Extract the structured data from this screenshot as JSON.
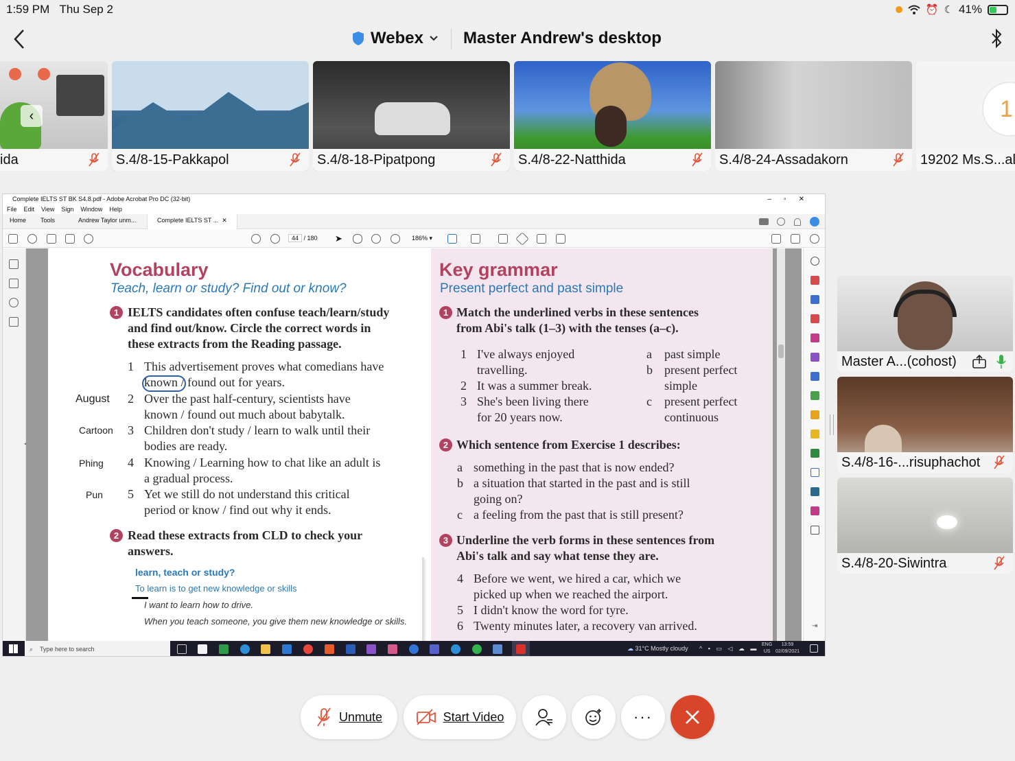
{
  "status_bar": {
    "time": "1:59 PM",
    "date": "Thu Sep 2",
    "battery": "41%",
    "battery_level": 0.41
  },
  "header": {
    "app": "Webex",
    "title": "Master Andrew's desktop"
  },
  "participants": [
    {
      "name": "ida"
    },
    {
      "name": "S.4/8-15-Pakkapol"
    },
    {
      "name": "S.4/8-18-Pipatpong"
    },
    {
      "name": "S.4/8-22-Natthida"
    },
    {
      "name": "S.4/8-24-Assadakorn"
    },
    {
      "name": "19202 Ms.S...al"
    }
  ],
  "video_column": [
    {
      "name": "Master A...(cohost)"
    },
    {
      "name": "S.4/8-16-...risuphachot"
    },
    {
      "name": "S.4/8-20-Siwintra"
    }
  ],
  "acrobat": {
    "title": "Complete IELTS ST BK S4.8.pdf - Adobe Acrobat Pro DC (32-bit)",
    "menu": [
      "File",
      "Edit",
      "View",
      "Sign",
      "Window",
      "Help"
    ],
    "tabs": [
      "Home",
      "Tools",
      "Andrew Taylor unm...",
      "Complete IELTS ST ..."
    ],
    "page_current": "44",
    "page_total": "/ 180",
    "zoom": "186%"
  },
  "vocab": {
    "title": "Vocabulary",
    "subtitle": "Teach, learn or study? Find out or know?",
    "q1": "IELTS candidates often confuse teach/learn/study and find out/know. Circle the correct words in these extracts from the Reading passage.",
    "q1_lines": [
      "IELTS candidates often confuse teach/learn/study",
      "and find out/know. Circle the correct words in",
      "these extracts from the Reading passage."
    ],
    "items": [
      {
        "n": "1",
        "l1": "This advertisement proves what comedians have",
        "l2": "known / found out for years."
      },
      {
        "n": "2",
        "l1": "Over the past half-century, scientists have",
        "l2": "known / found out much about babytalk."
      },
      {
        "n": "3",
        "l1": "Children don't study / learn to walk until their",
        "l2": "bodies are ready."
      },
      {
        "n": "4",
        "l1": "Knowing / Learning how to chat like an adult is",
        "l2": "a gradual process."
      },
      {
        "n": "5",
        "l1": "Yet we still do not understand this critical",
        "l2": "period or know / find out why it ends."
      }
    ],
    "handwritten": [
      "August",
      "Cartoon",
      "Phing",
      "Pun"
    ],
    "q2_l1": "Read these extracts from CLD to check your",
    "q2_l2": "answers.",
    "box_title": "learn, teach or study?",
    "box_l1": "To learn is to get new knowledge or skills",
    "box_l2": "I want to learn how to drive.",
    "box_l3": "When you teach someone, you give them new knowledge or skills."
  },
  "grammar": {
    "title": "Key grammar",
    "subtitle": "Present perfect and past simple",
    "q1_l1": "Match the underlined verbs in these sentences",
    "q1_l2": "from Abi's talk (1–3) with the tenses (a–c).",
    "left": [
      {
        "n": "1",
        "t": "I've always enjoyed",
        "t2": "travelling."
      },
      {
        "n": "2",
        "t": "It was a summer break.",
        "t2": ""
      },
      {
        "n": "3",
        "t": "She's been living there",
        "t2": "for 20 years now."
      }
    ],
    "right": [
      {
        "n": "a",
        "t": "past simple",
        "t2": ""
      },
      {
        "n": "b",
        "t": "present perfect",
        "t2": "simple"
      },
      {
        "n": "c",
        "t": "present perfect",
        "t2": "continuous"
      }
    ],
    "q2": "Which sentence from Exercise 1 describes:",
    "q2_items": [
      {
        "n": "a",
        "t": "something in the past that is now ended?",
        "t2": ""
      },
      {
        "n": "b",
        "t": "a situation that started in the past and is still",
        "t2": "going on?"
      },
      {
        "n": "c",
        "t": "a feeling from the past that is still present?",
        "t2": ""
      }
    ],
    "q3_l1": "Underline the verb forms in these sentences from",
    "q3_l2": "Abi's talk and say what tense they are.",
    "q3_items": [
      {
        "n": "4",
        "t": "Before we went, we hired a car, which we",
        "t2": "picked up when we reached the airport."
      },
      {
        "n": "5",
        "t": "I didn't know the word for tyre.",
        "t2": ""
      },
      {
        "n": "6",
        "t": "Twenty minutes later, a recovery van arrived.",
        "t2": ""
      }
    ]
  },
  "taskbar": {
    "search": "Type here to search",
    "weather": "31°C  Mostly cloudy",
    "lang": "ENG",
    "region": "US",
    "time": "13:59",
    "date": "02/09/2021"
  },
  "controls": {
    "unmute": "Unmute",
    "start_video": "Start Video"
  },
  "colors": {
    "end_call": "#d9452b",
    "vocab_accent": "#b2425f",
    "blue_accent": "#2a79b6"
  }
}
